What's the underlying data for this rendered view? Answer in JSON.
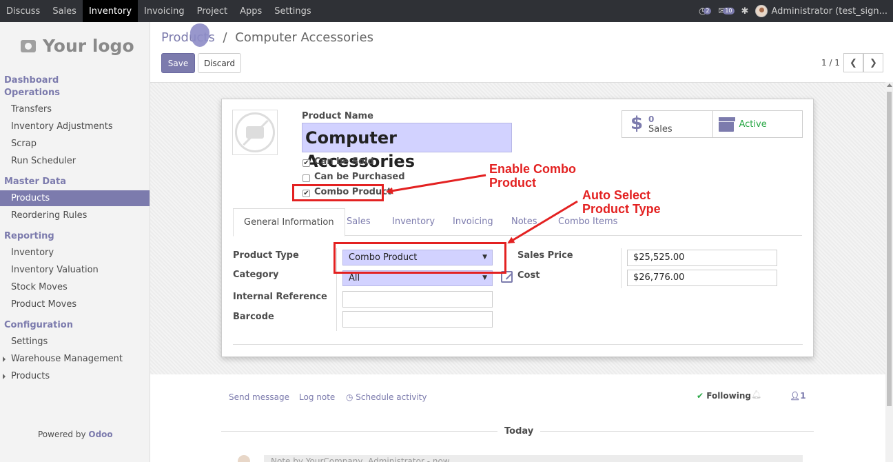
{
  "topbar": {
    "menu": [
      "Discuss",
      "Sales",
      "Inventory",
      "Invoicing",
      "Project",
      "Apps",
      "Settings"
    ],
    "active_index": 2,
    "activity_count": "2",
    "message_count": "10",
    "user": "Administrator (test_sign..."
  },
  "sidebar": {
    "logo_text": "Your logo",
    "dashboard": "Dashboard",
    "operations": "Operations",
    "operations_items": [
      "Transfers",
      "Inventory Adjustments",
      "Scrap",
      "Run Scheduler"
    ],
    "master_data": "Master Data",
    "master_items": [
      "Products",
      "Reordering Rules"
    ],
    "reporting": "Reporting",
    "reporting_items": [
      "Inventory",
      "Inventory Valuation",
      "Stock Moves",
      "Product Moves"
    ],
    "configuration": "Configuration",
    "configuration_items": [
      "Settings",
      "Warehouse Management",
      "Products"
    ],
    "powered_by": "Powered by",
    "powered_brand": "Odoo"
  },
  "control": {
    "breadcrumb_parent": "Products",
    "breadcrumb_sep": "/",
    "breadcrumb_current": "Computer Accessories",
    "save_label": "Save",
    "discard_label": "Discard",
    "pager": "1 / 1",
    "prev_glyph": "❮",
    "next_glyph": "❯"
  },
  "form": {
    "product_name_label": "Product Name",
    "product_name": "Computer Accessories",
    "can_be_sold": "Can be Sold",
    "can_be_purchased": "Can be Purchased",
    "combo_product": "Combo Product",
    "sales_count": "0",
    "sales_label": "Sales",
    "active_label": "Active",
    "tabs": [
      "General Information",
      "Sales",
      "Inventory",
      "Invoicing",
      "Notes",
      "Combo Items"
    ],
    "product_type_label": "Product Type",
    "product_type_value": "Combo Product",
    "category_label": "Category",
    "category_value": "All",
    "internal_reference_label": "Internal Reference",
    "barcode_label": "Barcode",
    "sales_price_label": "Sales Price",
    "sales_price_value": "$25,525.00",
    "cost_label": "Cost",
    "cost_value": "$26,776.00"
  },
  "annotations": {
    "enable_combo_line1": "Enable Combo",
    "enable_combo_line2": "Product",
    "auto_select_line1": "Auto Select",
    "auto_select_line2": "Product Type",
    "color": "#e32121"
  },
  "chatter": {
    "send_message": "Send message",
    "log_note": "Log note",
    "schedule_activity": "Schedule activity",
    "following": "Following",
    "followers": "1",
    "today": "Today",
    "message_preview": "Note by YourCompany, Administrator - now"
  },
  "colors": {
    "accent": "#7c7bad",
    "navbar": "#2f3136",
    "highlight_red": "#e32121",
    "active_green": "#28a745"
  }
}
